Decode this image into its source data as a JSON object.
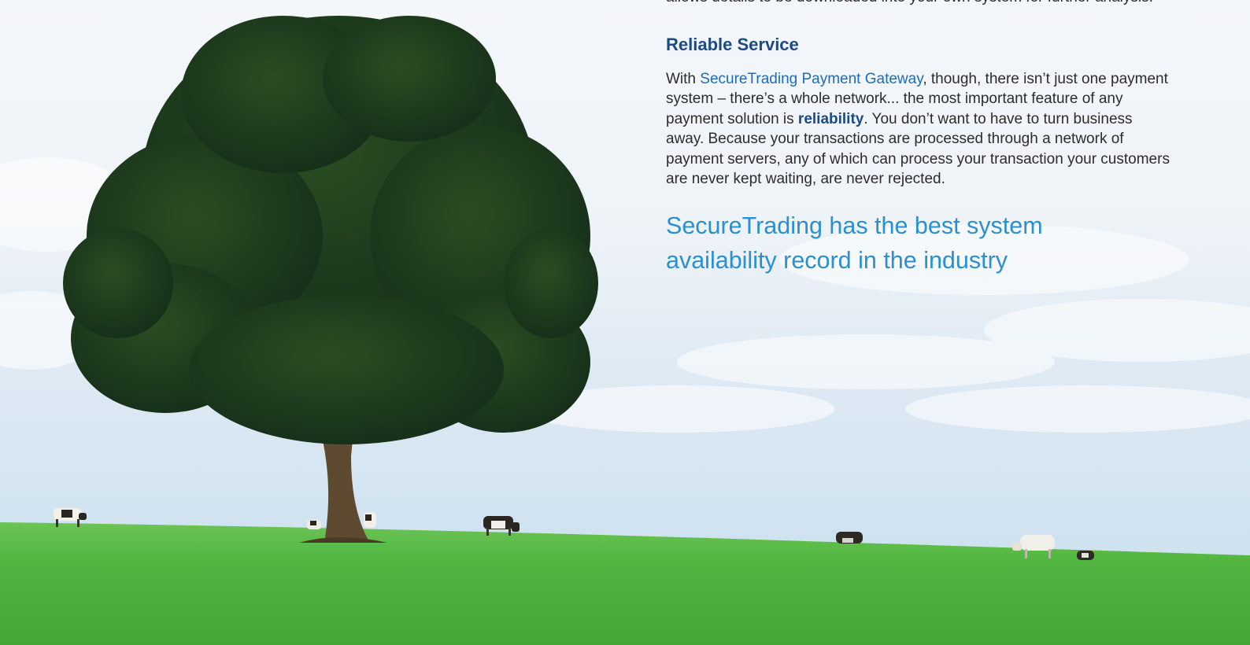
{
  "intro": {
    "continued_text": "allows details to be downloaded into your own system for further analysis."
  },
  "section": {
    "heading": "Reliable Service",
    "paragraph": {
      "prefix": "With ",
      "link_text": "SecureTrading Payment Gateway",
      "middle": ", though, there isn’t just one payment system – there’s a whole network... the most important feature of any payment solution is ",
      "bold_text": "reliability",
      "suffix": ". You don’t want to have to turn business away. Because your transactions are processed through a network of payment servers, any of which can process your transaction your customers are never kept waiting, are never rejected."
    },
    "pull_quote": "SecureTrading has the best system availability record in the industry"
  },
  "photo": {
    "subject": "oak tree in a green meadow with grazing cows",
    "colors": {
      "sky": "#e6eef6",
      "grass": "#4fb53f",
      "foliage": "#1f3d17",
      "trunk": "#5e4a30"
    }
  }
}
